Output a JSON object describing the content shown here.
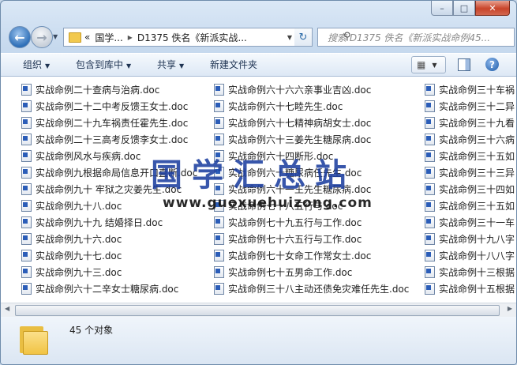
{
  "window": {
    "caption": {
      "minimize": "–",
      "maximize": "□",
      "close": "✕"
    }
  },
  "nav": {
    "back_icon": "arrow-left-icon",
    "forward_icon": "arrow-right-icon",
    "address_parts": [
      "«",
      "国学...",
      "▸",
      "D1375 佚名《新派实战..."
    ],
    "search_placeholder": "搜索 D1375 佚名《新派实战命例45..."
  },
  "toolbar": {
    "organize": "组织",
    "include": "包含到库中",
    "share": "共享",
    "new_folder": "新建文件夹"
  },
  "files": {
    "col1": [
      "实战命例二十查病与治病.doc",
      "实战命例二十二中考反馈王女士.doc",
      "实战命例二十九车祸责任霍先生.doc",
      "实战命例二十三高考反馈李女士.doc",
      "实战命例风水与疾病.doc",
      "实战命例九根据命局信息开口直断.doc",
      "实战命例九十 牢狱之灾姜先生.doc",
      "实战命例九十八.doc",
      "实战命例九十九 结婚择日.doc",
      "实战命例九十六.doc",
      "实战命例九十七.doc",
      "实战命例九十三.doc",
      "实战命例六十二辛女士糖尿病.doc"
    ],
    "col2": [
      "实战命例六十六六亲事业吉凶.doc",
      "实战命例六十七睦先生.doc",
      "实战命例六十七精神病胡女士.doc",
      "实战命例六十三姜先生糖尿病.doc",
      "实战命例六十四断形.doc",
      "实战命例六十糖尿病任先生.doc",
      "实战命例六十一王先生糖尿病.doc",
      "实战命例七十八五行与.doc",
      "实战命例七十九五行与工作.doc",
      "实战命例七十六五行与工作.doc",
      "实战命例七十女命工作常女士.doc",
      "实战命例七十五男命工作.doc",
      "实战命例三十八主动还债免灾难任先生.doc"
    ],
    "col3": [
      "实战命例三十车祸",
      "实战命例三十二异",
      "实战命例三十九看",
      "实战命例三十六病",
      "实战命例三十五如",
      "实战命例三十三异",
      "实战命例三十四如",
      "实战命例三十五如",
      "实战命例三十一车",
      "实战命例十九八字",
      "实战命例十八八字",
      "实战命例十三根据",
      "实战命例十五根据"
    ]
  },
  "status": {
    "count": "45 个对象"
  },
  "watermark": {
    "line1": "国学汇总站",
    "line2": "www.guoxuehuizong.com"
  }
}
